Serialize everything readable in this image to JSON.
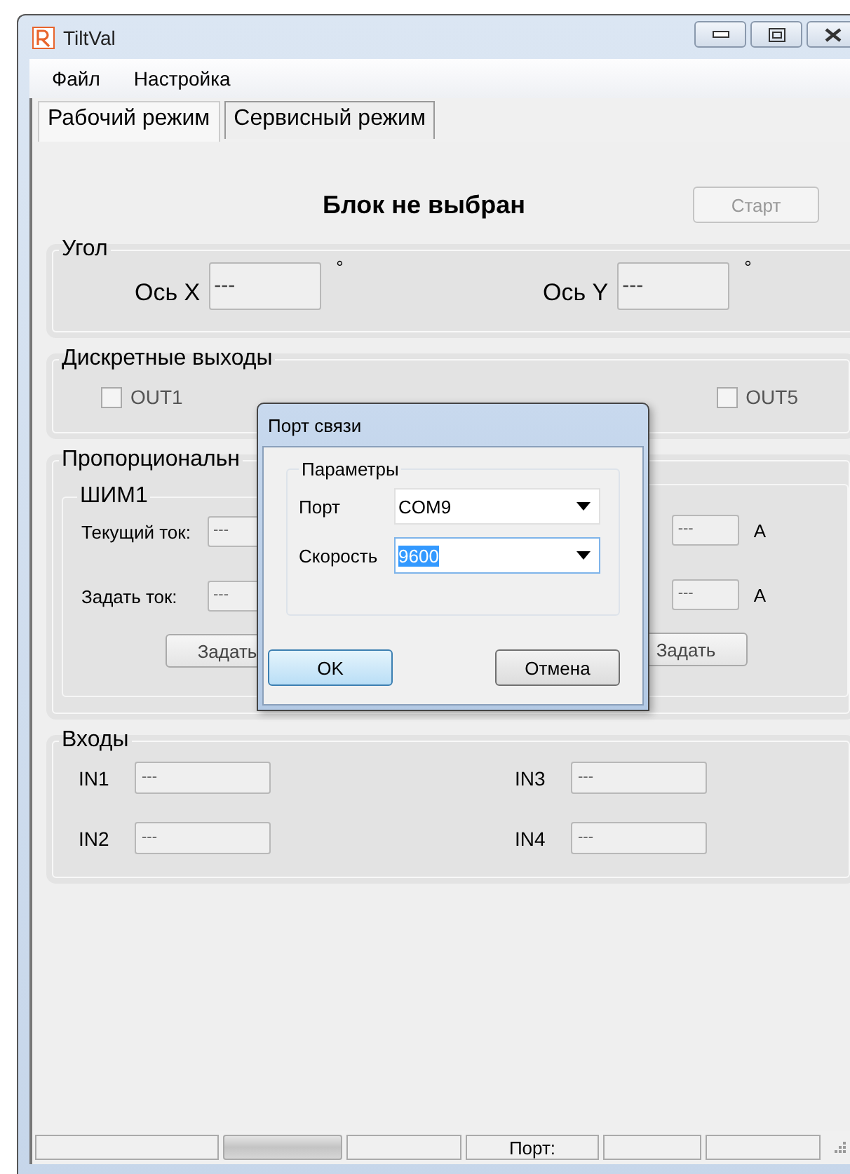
{
  "window": {
    "title": "TiltVal"
  },
  "menu": [
    "Файл",
    "Настройка"
  ],
  "tabs": [
    {
      "label": "Рабочий режим",
      "selected": true
    },
    {
      "label": "Сервисный режим",
      "selected": false
    }
  ],
  "header": {
    "status": "Блок не выбран",
    "start_button": {
      "label": "Старт",
      "disabled": true
    }
  },
  "angle_group": {
    "title": "Угол",
    "axes": [
      {
        "label": "Ось X",
        "value": "---",
        "unit": "°"
      },
      {
        "label": "Ось Y",
        "value": "---",
        "unit": "°"
      }
    ]
  },
  "outputs_group": {
    "title": "Дискретные выходы",
    "outputs": [
      {
        "label": "OUT1",
        "checked": false
      },
      {
        "label": "OUT5",
        "checked": false
      }
    ]
  },
  "proportional_group": {
    "title": "Пропорциональн",
    "channels": [
      {
        "title": "ШИМ1",
        "rows": [
          {
            "label": "Текущий ток:",
            "value": "---"
          },
          {
            "label": "Задать ток:",
            "value": "---"
          }
        ],
        "button": "Задать"
      },
      {
        "rows": [
          {
            "value": "---",
            "unit": "A"
          },
          {
            "value": "---",
            "unit": "A"
          }
        ],
        "button": "Задать"
      }
    ]
  },
  "inputs_group": {
    "title": "Входы",
    "inputs": [
      {
        "label": "IN1",
        "value": "---"
      },
      {
        "label": "IN3",
        "value": "---"
      },
      {
        "label": "IN2",
        "value": "---"
      },
      {
        "label": "IN4",
        "value": "---"
      }
    ]
  },
  "status_bar": {
    "port_label": "Порт:"
  },
  "dialog": {
    "title": "Порт связи",
    "group_title": "Параметры",
    "fields": [
      {
        "label": "Порт",
        "value": "COM9",
        "highlighted": false
      },
      {
        "label": "Скорость",
        "value": "9600",
        "highlighted": true
      }
    ],
    "buttons": [
      {
        "label": "OK",
        "default": true
      },
      {
        "label": "Отмена",
        "default": false
      }
    ]
  }
}
